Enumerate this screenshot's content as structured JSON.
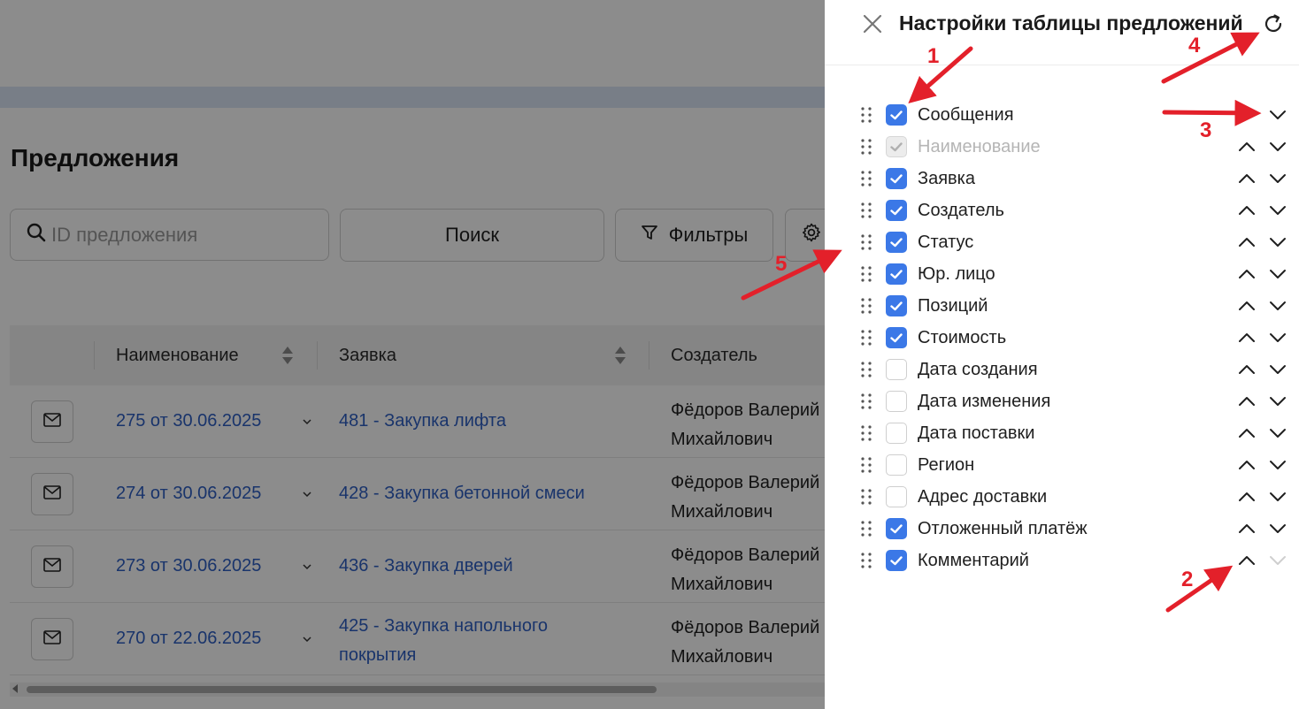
{
  "page": {
    "title": "Предложения",
    "search": {
      "placeholder": "ID предложения",
      "value": ""
    },
    "search_button": "Поиск",
    "filters_button": "Фильтры",
    "table": {
      "headers": [
        "Наименование",
        "Заявка",
        "Создатель"
      ],
      "rows": [
        {
          "offer": "275 от 30.06.2025",
          "request_line1": "481 - Закупка лифта",
          "request_line2": "",
          "creator_line1": "Фёдоров Валерий",
          "creator_line2": "Михайлович"
        },
        {
          "offer": "274 от 30.06.2025",
          "request_line1": "428 - Закупка бетонной смеси",
          "request_line2": "",
          "creator_line1": "Фёдоров Валерий",
          "creator_line2": "Михайлович"
        },
        {
          "offer": "273 от 30.06.2025",
          "request_line1": "436 - Закупка дверей",
          "request_line2": "",
          "creator_line1": "Фёдоров Валерий",
          "creator_line2": "Михайлович"
        },
        {
          "offer": "270 от 22.06.2025",
          "request_line1": "425 - Закупка напольного",
          "request_line2": "покрытия",
          "creator_line1": "Фёдоров Валерий",
          "creator_line2": "Михайлович"
        }
      ]
    }
  },
  "panel": {
    "title": "Настройки таблицы предложений",
    "columns": [
      {
        "label": "Сообщения",
        "checked": true,
        "disabled": false,
        "up": false,
        "down": true
      },
      {
        "label": "Наименование",
        "checked": true,
        "disabled": true,
        "up": true,
        "down": true
      },
      {
        "label": "Заявка",
        "checked": true,
        "disabled": false,
        "up": true,
        "down": true
      },
      {
        "label": "Создатель",
        "checked": true,
        "disabled": false,
        "up": true,
        "down": true
      },
      {
        "label": "Статус",
        "checked": true,
        "disabled": false,
        "up": true,
        "down": true
      },
      {
        "label": "Юр. лицо",
        "checked": true,
        "disabled": false,
        "up": true,
        "down": true
      },
      {
        "label": "Позиций",
        "checked": true,
        "disabled": false,
        "up": true,
        "down": true
      },
      {
        "label": "Стоимость",
        "checked": true,
        "disabled": false,
        "up": true,
        "down": true
      },
      {
        "label": "Дата создания",
        "checked": false,
        "disabled": false,
        "up": true,
        "down": true
      },
      {
        "label": "Дата изменения",
        "checked": false,
        "disabled": false,
        "up": true,
        "down": true
      },
      {
        "label": "Дата поставки",
        "checked": false,
        "disabled": false,
        "up": true,
        "down": true
      },
      {
        "label": "Регион",
        "checked": false,
        "disabled": false,
        "up": true,
        "down": true
      },
      {
        "label": "Адрес доставки",
        "checked": false,
        "disabled": false,
        "up": true,
        "down": true
      },
      {
        "label": "Отложенный платёж",
        "checked": true,
        "disabled": false,
        "up": true,
        "down": true
      },
      {
        "label": "Комментарий",
        "checked": true,
        "disabled": false,
        "up": true,
        "down": false
      }
    ]
  },
  "annotations": [
    "1",
    "2",
    "3",
    "4",
    "5"
  ],
  "colors": {
    "accent": "#3b78e7",
    "link": "#2f5fc4",
    "annotation": "#e3202a",
    "overlay": "rgba(0,0,0,0.45)"
  }
}
